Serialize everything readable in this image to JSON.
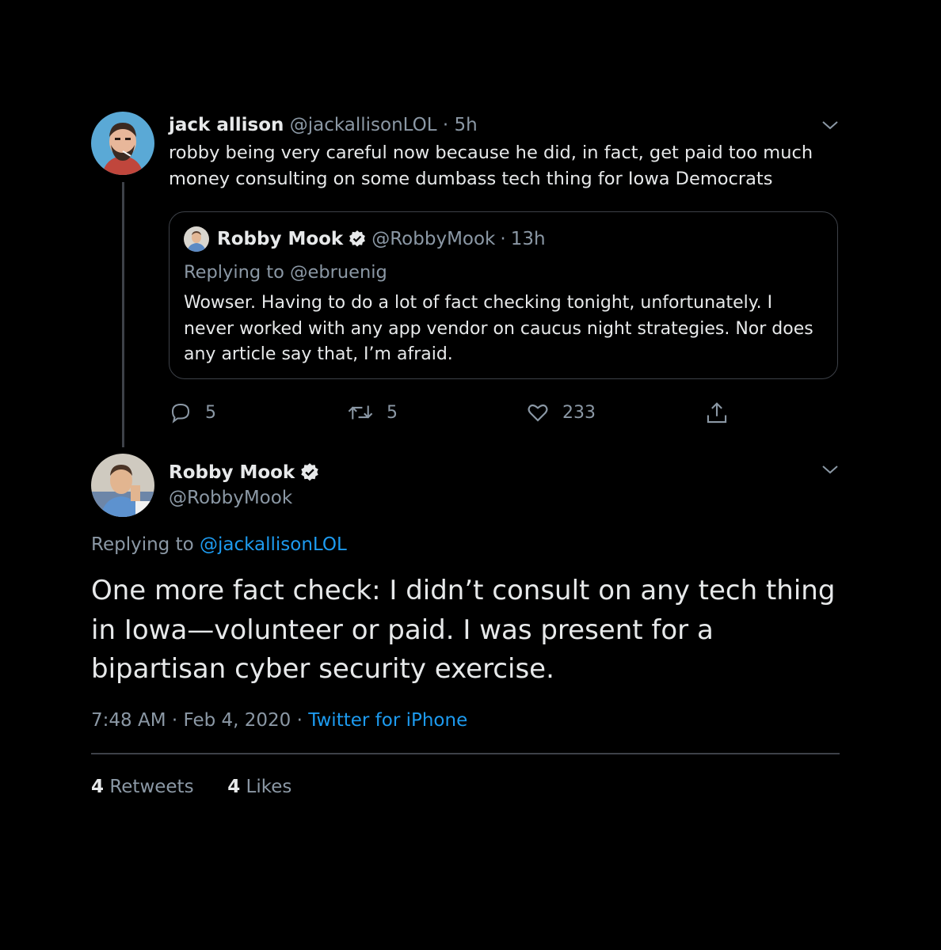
{
  "colors": {
    "background": "#000000",
    "text": "#e7e9ea",
    "muted": "#8b98a5",
    "link": "#1d9bf0",
    "border": "#3d4148"
  },
  "reply_tweet": {
    "name": "jack allison",
    "handle": "@jackallisonLOL",
    "separator": "·",
    "time": "5h",
    "text": "robby being very careful now because he did, in fact, get paid too much money consulting on some dumbass tech thing for Iowa Democrats",
    "quoted": {
      "name": "Robby Mook",
      "handle": "@RobbyMook",
      "separator": "·",
      "time": "13h",
      "replying_to": "Replying to @ebruenig",
      "text": "Wowser.  Having to do a lot of fact checking tonight, unfortunately.  I never worked with any app vendor on caucus night strategies.  Nor does any article say that, I’m afraid."
    },
    "actions": {
      "replies": "5",
      "retweets": "5",
      "likes": "233"
    }
  },
  "main_tweet": {
    "name": "Robby Mook",
    "handle": "@RobbyMook",
    "replying_prefix": "Replying to",
    "replying_handle": "@jackallisonLOL",
    "text": "One more fact check: I didn’t consult on any tech thing in Iowa—volunteer or paid.  I was present for a bipartisan cyber security exercise.",
    "time": "7:48 AM",
    "sep1": "·",
    "date": "Feb 4, 2020",
    "sep2": "·",
    "source": "Twitter for iPhone",
    "retweets_count": "4",
    "retweets_label": "Retweets",
    "likes_count": "4",
    "likes_label": "Likes"
  }
}
